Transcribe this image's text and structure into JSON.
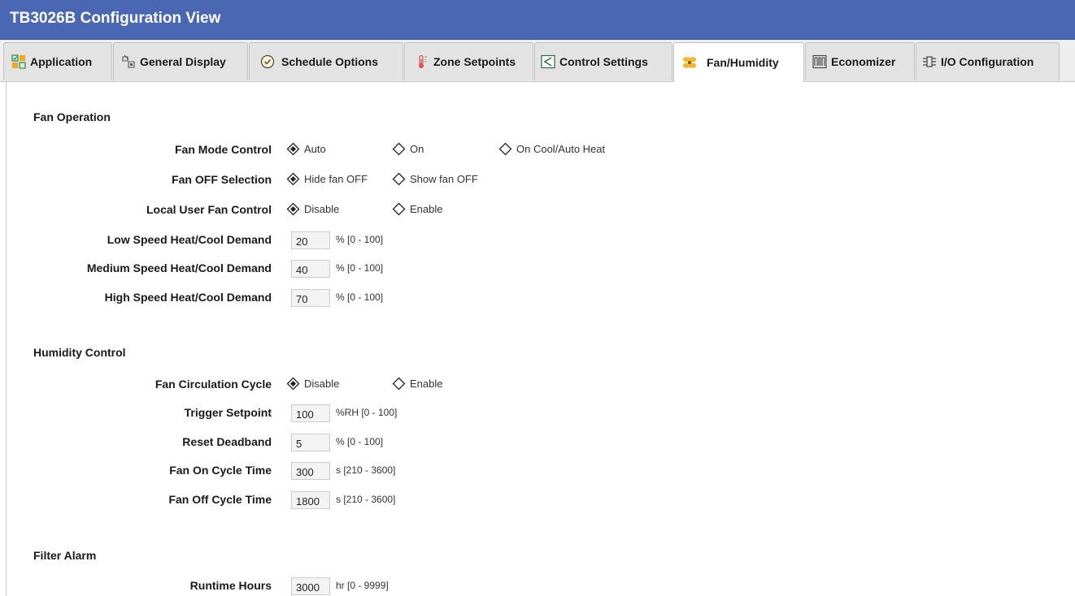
{
  "window": {
    "title": "TB3026B Configuration View"
  },
  "tabs": [
    {
      "label": "Application",
      "icon": "application-icon"
    },
    {
      "label": "General Display",
      "icon": "general-display-icon"
    },
    {
      "label": "Schedule Options",
      "icon": "schedule-icon"
    },
    {
      "label": "Zone Setpoints",
      "icon": "thermometer-icon"
    },
    {
      "label": "Control Settings",
      "icon": "control-settings-icon"
    },
    {
      "label": "Fan/Humidity",
      "icon": "fan-icon",
      "active": true
    },
    {
      "label": "Economizer",
      "icon": "economizer-icon"
    },
    {
      "label": "I/O Configuration",
      "icon": "io-configuration-icon"
    }
  ],
  "colors": {
    "title_bar": "#4a67b3",
    "title_text": "#ffffff",
    "field_background": "#f3f3f3"
  },
  "fan_operation": {
    "heading": "Fan Operation",
    "fan_mode_control": {
      "label": "Fan Mode Control",
      "options": [
        "Auto",
        "On",
        "On Cool/Auto Heat"
      ],
      "selected": "Auto"
    },
    "fan_off_selection": {
      "label": "Fan OFF Selection",
      "options": [
        "Hide fan OFF",
        "Show fan OFF"
      ],
      "selected": "Hide fan OFF"
    },
    "local_user_fan_control": {
      "label": "Local User Fan Control",
      "options": [
        "Disable",
        "Enable"
      ],
      "selected": "Disable"
    },
    "low_speed_demand": {
      "label": "Low Speed Heat/Cool Demand",
      "value": "20",
      "range": "% [0 - 100]"
    },
    "medium_speed_demand": {
      "label": "Medium Speed Heat/Cool Demand",
      "value": "40",
      "range": "% [0 - 100]"
    },
    "high_speed_demand": {
      "label": "High Speed Heat/Cool Demand",
      "value": "70",
      "range": "% [0 - 100]"
    }
  },
  "humidity_control": {
    "heading": "Humidity Control",
    "fan_circulation_cycle": {
      "label": "Fan Circulation Cycle",
      "options": [
        "Disable",
        "Enable"
      ],
      "selected": "Disable"
    },
    "trigger_setpoint": {
      "label": "Trigger Setpoint",
      "value": "100",
      "range": "%RH [0 - 100]"
    },
    "reset_deadband": {
      "label": "Reset Deadband",
      "value": "5",
      "range": "% [0 - 100]"
    },
    "fan_on_cycle_time": {
      "label": "Fan On Cycle Time",
      "value": "300",
      "range": "s [210 - 3600]"
    },
    "fan_off_cycle_time": {
      "label": "Fan Off Cycle Time",
      "value": "1800",
      "range": "s [210 - 3600]"
    }
  },
  "filter_alarm": {
    "heading": "Filter Alarm",
    "runtime_hours": {
      "label": "Runtime Hours",
      "value": "3000",
      "range": "hr [0 - 9999]"
    }
  }
}
